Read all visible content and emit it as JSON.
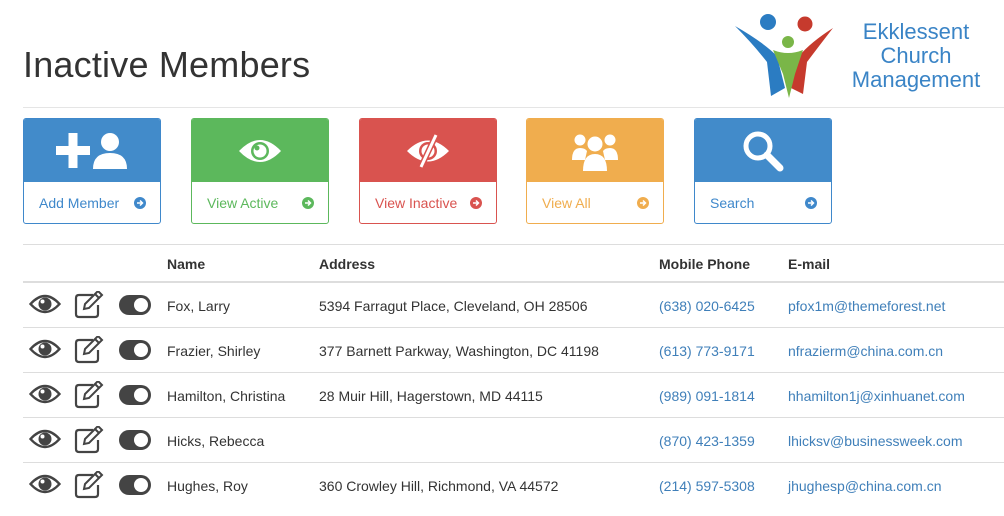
{
  "page": {
    "title": "Inactive Members"
  },
  "logo": {
    "line1": "Ekklessent",
    "line2": "Church",
    "line3": "Management"
  },
  "tiles": [
    {
      "label": "Add Member",
      "icon": "add-user-icon",
      "color": "#428bca"
    },
    {
      "label": "View Active",
      "icon": "eye-icon",
      "color": "#5cb85c"
    },
    {
      "label": "View Inactive",
      "icon": "eye-slash-icon",
      "color": "#d9534f"
    },
    {
      "label": "View All",
      "icon": "users-icon",
      "color": "#f0ad4e"
    },
    {
      "label": "Search",
      "icon": "search-icon",
      "color": "#428bca"
    }
  ],
  "table": {
    "headers": {
      "name": "Name",
      "address": "Address",
      "phone": "Mobile Phone",
      "email": "E-mail"
    },
    "rows": [
      {
        "name": "Fox, Larry",
        "address": "5394 Farragut Place, Cleveland, OH 28506",
        "phone": "(638) 020-6425",
        "email": "pfox1m@themeforest.net"
      },
      {
        "name": "Frazier, Shirley",
        "address": "377 Barnett Parkway, Washington, DC 41198",
        "phone": "(613) 773-9171",
        "email": "nfrazierm@china.com.cn"
      },
      {
        "name": "Hamilton, Christina",
        "address": "28 Muir Hill, Hagerstown, MD 44115",
        "phone": "(989) 091-1814",
        "email": "hhamilton1j@xinhuanet.com"
      },
      {
        "name": "Hicks, Rebecca",
        "address": "",
        "phone": "(870) 423-1359",
        "email": "lhicksv@businessweek.com"
      },
      {
        "name": "Hughes, Roy",
        "address": "360 Crowley Hill, Richmond, VA 44572",
        "phone": "(214) 597-5308",
        "email": "jhughesp@china.com.cn"
      }
    ]
  }
}
